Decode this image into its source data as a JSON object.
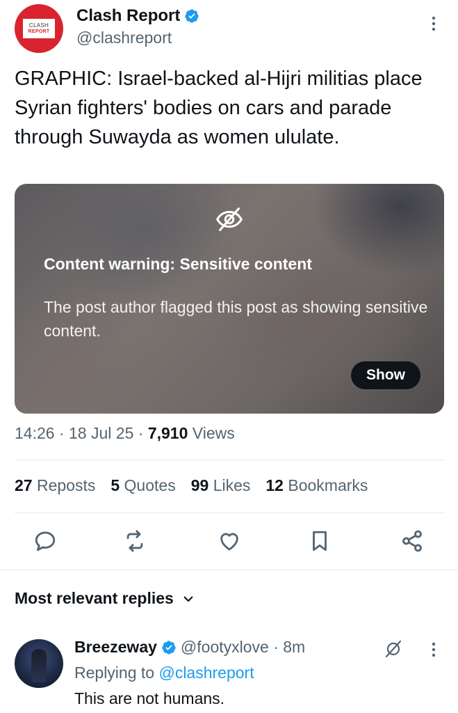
{
  "tweet": {
    "avatar_text_line1": "CLASH",
    "avatar_text_line2": "REPORT",
    "author_name": "Clash Report",
    "author_handle": "@clashreport",
    "text": "GRAPHIC: Israel-backed al-Hijri militias place Syrian fighters' bodies on cars and parade through Suwayda as women ululate.",
    "media": {
      "warning_title": "Content warning: Sensitive content",
      "warning_body": "The post author flagged this post as showing sensitive content.",
      "show_label": "Show"
    },
    "time": "14:26",
    "date": "18 Jul 25",
    "views_count": "7,910",
    "views_label": "Views",
    "separator": " · "
  },
  "stats": {
    "reposts_count": "27",
    "reposts_label": "Reposts",
    "quotes_count": "5",
    "quotes_label": "Quotes",
    "likes_count": "99",
    "likes_label": "Likes",
    "bookmarks_count": "12",
    "bookmarks_label": "Bookmarks"
  },
  "actions": [
    "reply-icon",
    "repost-icon",
    "like-icon",
    "bookmark-icon",
    "share-icon"
  ],
  "replies_section": {
    "title": "Most relevant replies"
  },
  "reply": {
    "name": "Breezeway",
    "handle": "@footyxlove · 8m",
    "replying_to_prefix": "Replying to ",
    "replying_to_mention": "@clashreport",
    "text": "This are not humans."
  },
  "colors": {
    "verified_blue": "#1d9bf0",
    "secondary_text": "#536471",
    "brand_red": "#d9232e"
  }
}
